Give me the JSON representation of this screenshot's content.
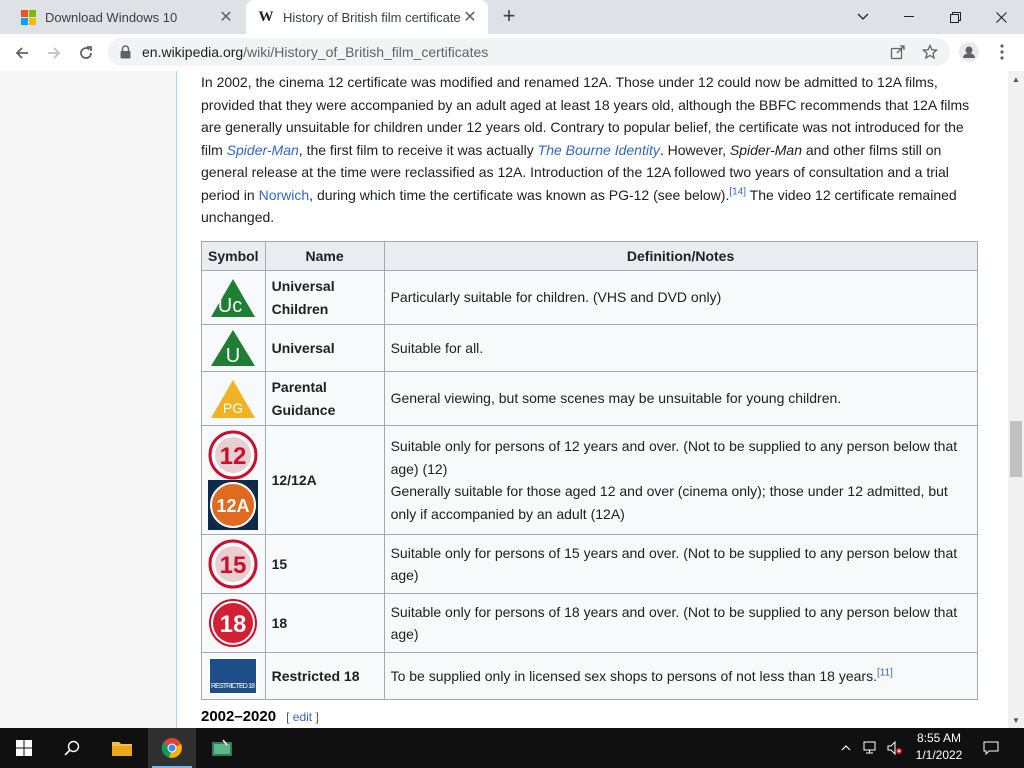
{
  "tabs": [
    {
      "title": "Download Windows 10",
      "favicon": "microsoft-icon"
    },
    {
      "title": "History of British film certificates",
      "favicon": "wikipedia-icon"
    }
  ],
  "address": {
    "domain": "en.wikipedia.org",
    "path": "/wiki/History_of_British_film_certificates"
  },
  "paragraph": {
    "t1": "In 2002, the cinema 12 certificate was modified and renamed 12A. Those under 12 could now be admitted to 12A films, provided that they were accompanied by an adult aged at least 18 years old, although the BBFC recommends that 12A films are generally unsuitable for children under 12 years old. Contrary to popular belief, the certificate was not introduced for the film ",
    "link_spiderman": "Spider-Man",
    "t2": ", the first film to receive it was actually ",
    "link_bourne": "The Bourne Identity",
    "t3": ". However, ",
    "spiderman_italic": "Spider-Man",
    "t4": " and other films still on general release at the time were reclassified as 12A. Introduction of the 12A followed two years of consultation and a trial period in ",
    "link_norwich": "Norwich",
    "t5": ", during which time the certificate was known as PG-12 (see below).",
    "ref14": "[14]",
    "t6": " The video 12 certificate remained unchanged."
  },
  "table": {
    "headers": {
      "symbol": "Symbol",
      "name": "Name",
      "definition": "Definition/Notes"
    },
    "rows": [
      {
        "name": "Universal Children",
        "definition": "Particularly suitable for children. (VHS and DVD only)",
        "symbol_text": "Uc"
      },
      {
        "name": "Universal",
        "definition": "Suitable for all.",
        "symbol_text": "U"
      },
      {
        "name": "Parental Guidance",
        "definition": "General viewing, but some scenes may be unsuitable for young children.",
        "symbol_text": "PG"
      },
      {
        "name": "12/12A",
        "definition": "Suitable only for persons of 12 years and over. (Not to be supplied to any person below that age) (12)",
        "definition2": "Generally suitable for those aged 12 and over (cinema only); those under 12 admitted, but only if accompanied by an adult (12A)",
        "symbol_text": "12",
        "symbol_text2": "12A"
      },
      {
        "name": "15",
        "definition": "Suitable only for persons of 15 years and over. (Not to be supplied to any person below that age)",
        "symbol_text": "15"
      },
      {
        "name": "18",
        "definition": "Suitable only for persons of 18 years and over. (Not to be supplied to any person below that age)",
        "symbol_text": "18"
      },
      {
        "name": "Restricted 18",
        "definition": "To be supplied only in licensed sex shops to persons of not less than 18 years.",
        "ref": "[11]",
        "symbol_text": "RESTRICTED 18"
      }
    ]
  },
  "section": {
    "heading": "2002–2020",
    "edit_open": "[ ",
    "edit_label": "edit",
    "edit_close": " ]"
  },
  "taskbar": {
    "time": "8:55 AM",
    "date": "1/1/2022"
  },
  "colors": {
    "universal_green": "#1e7e34",
    "pg_yellow": "#f0b323",
    "red_12": "#c8102e",
    "r18_blue": "#1d4e89"
  }
}
